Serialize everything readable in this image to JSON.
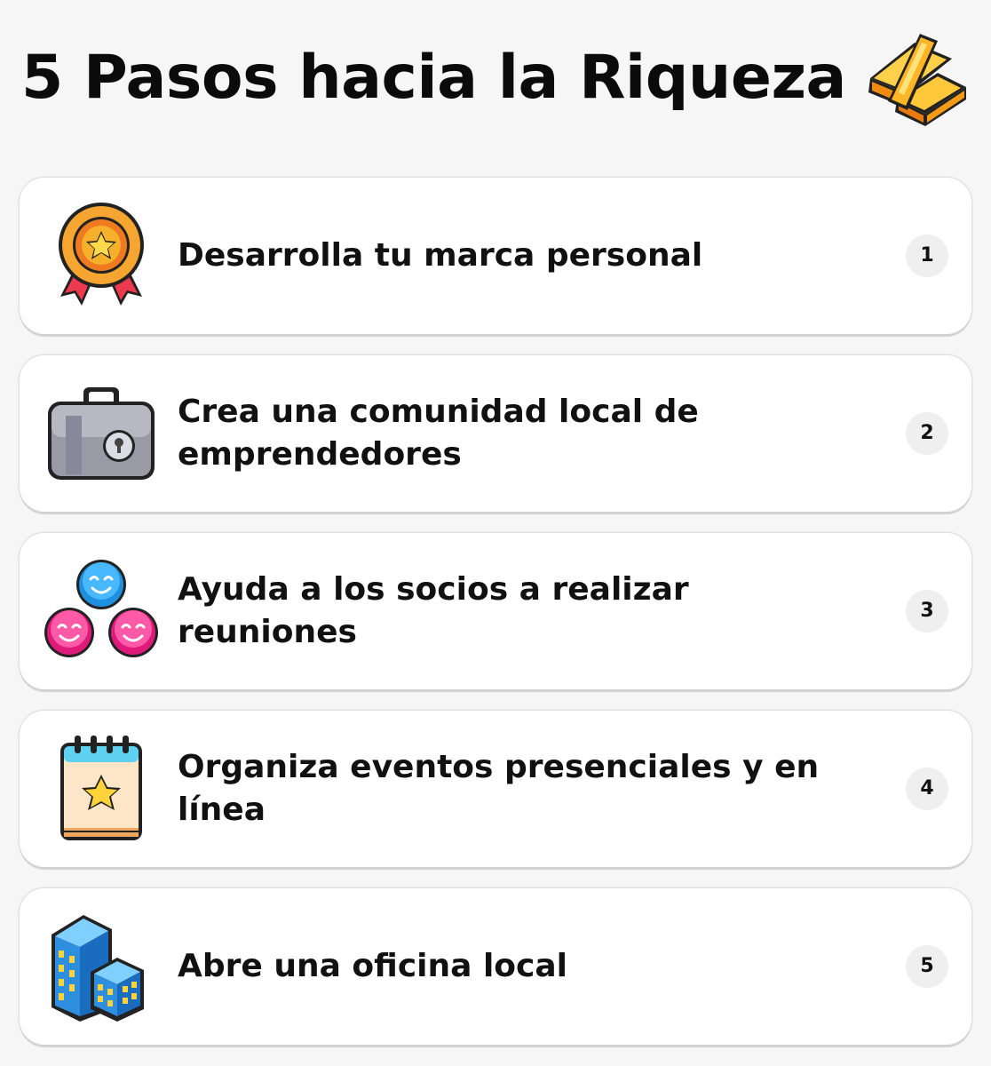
{
  "title": "5 Pasos hacia la Riqueza",
  "header_icon": "gold-bars-icon",
  "steps": [
    {
      "label": "Desarrolla tu marca personal",
      "number": "1",
      "icon": "medal-icon"
    },
    {
      "label": "Crea una comunidad local de emprendedores",
      "number": "2",
      "icon": "briefcase-icon"
    },
    {
      "label": "Ayuda a los socios a realizar reuniones",
      "number": "3",
      "icon": "people-group-icon"
    },
    {
      "label": "Organiza eventos presenciales y en línea",
      "number": "4",
      "icon": "calendar-star-icon"
    },
    {
      "label": "Abre una oficina local",
      "number": "5",
      "icon": "office-buildings-icon"
    }
  ],
  "colors": {
    "background": "#f6f6f6",
    "card": "#ffffff",
    "badge": "#efefef",
    "text": "#111111"
  }
}
